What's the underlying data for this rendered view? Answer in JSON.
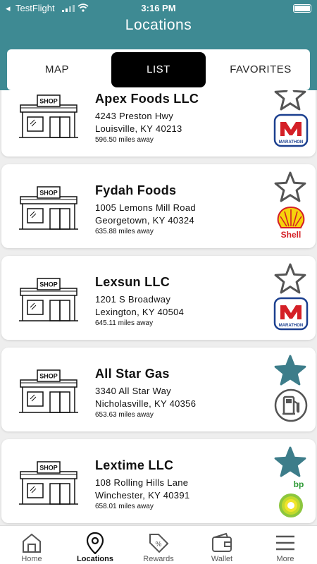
{
  "status_bar": {
    "carrier": "TestFlight",
    "time": "3:16 PM"
  },
  "header": {
    "title": "Locations"
  },
  "tabs": [
    {
      "label": "MAP"
    },
    {
      "label": "LIST"
    },
    {
      "label": "FAVORITES"
    }
  ],
  "shop_sign": "SHOP",
  "locations": [
    {
      "name": "Apex Foods LLC",
      "address": "4243 Preston Hwy",
      "city": "Louisville, KY 40213",
      "distance": "596.50 miles away",
      "favorite": false,
      "brand": "marathon-icon",
      "brand_text": "MARATHON"
    },
    {
      "name": "Fydah Foods",
      "address": "1005 Lemons Mill Road",
      "city": "Georgetown, KY 40324",
      "distance": "635.88 miles away",
      "favorite": false,
      "brand": "shell-icon",
      "brand_text": "Shell"
    },
    {
      "name": "Lexsun LLC",
      "address": "1201 S Broadway",
      "city": "Lexington, KY 40504",
      "distance": "645.11 miles away",
      "favorite": false,
      "brand": "marathon-icon",
      "brand_text": "MARATHON"
    },
    {
      "name": "All Star Gas",
      "address": "3340 All Star Way",
      "city": "Nicholasville, KY 40356",
      "distance": "653.63 miles away",
      "favorite": true,
      "brand": "gas-pump-icon",
      "brand_text": ""
    },
    {
      "name": "Lextime LLC",
      "address": "108 Rolling Hills Lane",
      "city": "Winchester, KY 40391",
      "distance": "658.01 miles away",
      "favorite": true,
      "brand": "bp-icon",
      "brand_text": "bp"
    }
  ],
  "bottom_nav": [
    {
      "label": "Home",
      "icon": "home-icon"
    },
    {
      "label": "Locations",
      "icon": "location-pin-icon",
      "active": true
    },
    {
      "label": "Rewards",
      "icon": "rewards-tag-icon"
    },
    {
      "label": "Wallet",
      "icon": "wallet-icon"
    },
    {
      "label": "More",
      "icon": "menu-icon"
    }
  ],
  "colors": {
    "teal": "#3e8a93",
    "favorite_star": "#3d7d8a",
    "outline_star": "#555555"
  }
}
